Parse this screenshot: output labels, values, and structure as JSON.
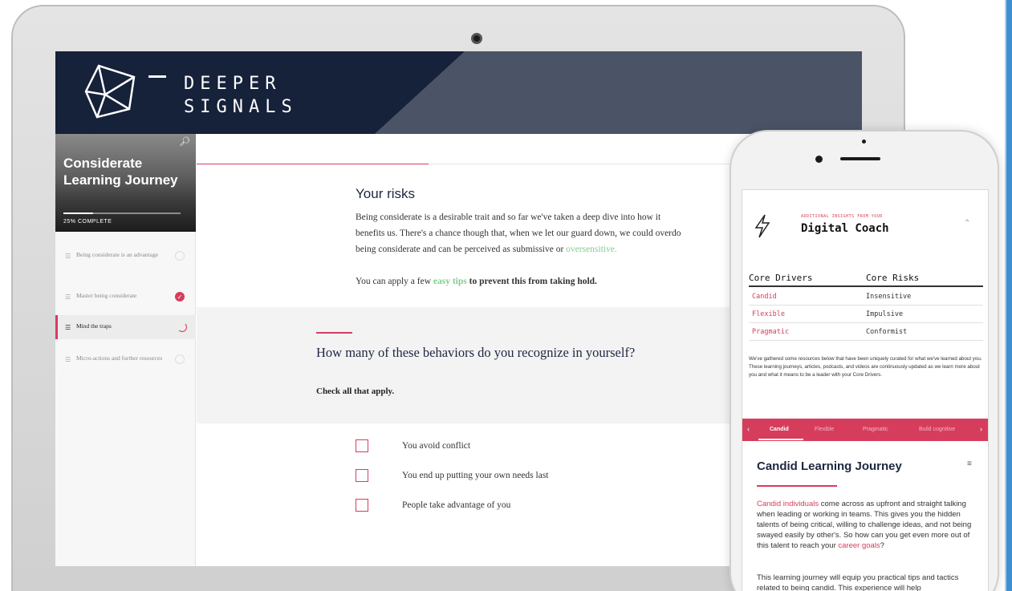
{
  "brand": {
    "line1": "DEEPER",
    "line2": "SIGNALS"
  },
  "sidebar": {
    "title": "Considerate Learning Journey",
    "progress_label": "25% COMPLETE",
    "progress": 0.25,
    "items": [
      {
        "label": "Being considerate is an advantage",
        "status": "not-started"
      },
      {
        "label": "Master being considerate",
        "status": "complete"
      },
      {
        "label": "Mind the traps",
        "status": "in-progress"
      },
      {
        "label": "Micro-actions and further resources",
        "status": "not-started"
      }
    ]
  },
  "content": {
    "risks_title": "Your risks",
    "risks_line1": "Being considerate is a desirable trait and so far we've taken a deep dive into how it",
    "risks_line2": "benefits us. There's a chance though that, when we let our guard down, we could overdo",
    "risks_line3_a": "being considerate and can be perceived as submissive or ",
    "risks_line3_link": "oversensitive.",
    "tip_a": "You can apply a few ",
    "tip_link": "easy tips",
    "tip_b": " to prevent this from taking hold.",
    "question": "How many of these behaviors do you recognize in yourself?",
    "instruction": "Check all that apply.",
    "options": [
      {
        "label": "You avoid conflict"
      },
      {
        "label": "You end up putting your own needs last"
      },
      {
        "label": "People take advantage of you"
      }
    ]
  },
  "phone": {
    "coach_small": "ADDITIONAL INSIGHTS FROM YOUR",
    "coach_title": "Digital Coach",
    "drivers_header": "Core Drivers",
    "risks_header": "Core Risks",
    "rows": [
      {
        "driver": "Candid",
        "risk": "Insensitive"
      },
      {
        "driver": "Flexible",
        "risk": "Impulsive"
      },
      {
        "driver": "Pragmatic",
        "risk": "Conformist"
      }
    ],
    "resources_text": "We've gathered some resources below that have been uniquely curated for what we've learned about you. These learning journeys, articles, podcasts, and videos are continuously updated as we learn more about you and what it means to be a leader with your Core Drivers.",
    "tabs": [
      "Candid",
      "Flexible",
      "Pragmatic",
      "Build cognitive"
    ],
    "journey_title": "Candid Learning Journey",
    "body1_link": "Candid individuals",
    "body1": " come across as upfront and straight talking when leading or working in teams. This gives you the hidden talents of being critical, willing to challenge ideas, and not being swayed easily by other's. So how can you get even more out of this talent to reach your ",
    "body1_link2": "career goals",
    "body1_end": "?",
    "body2": "This learning journey will equip you practical tips and tactics related to being candid. This experience will help"
  },
  "colors": {
    "accent": "#d63d5c",
    "navy": "#16213a",
    "link_green": "#7fce8b",
    "frame_blue": "#3d8fd1"
  }
}
